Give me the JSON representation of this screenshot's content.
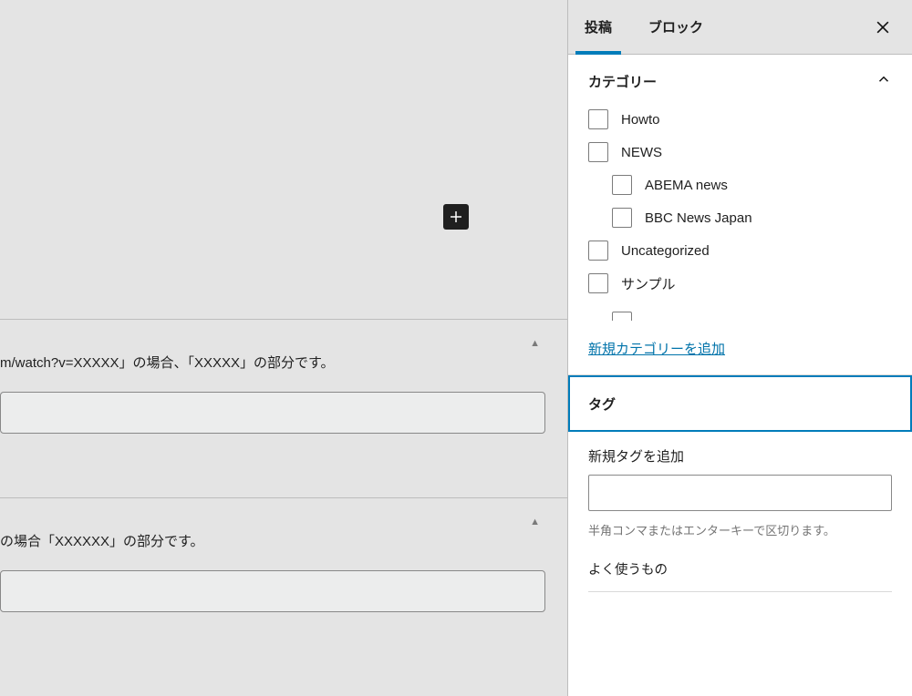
{
  "editor": {
    "section1_desc": "m/watch?v=XXXXX」の場合、「XXXXX」の部分です。",
    "section2_desc": "の場合「XXXXXX」の部分です。",
    "triangle_glyph": "▲"
  },
  "panel": {
    "tabs": {
      "post": "投稿",
      "block": "ブロック"
    },
    "categories": {
      "title": "カテゴリー",
      "items": [
        {
          "label": "Howto",
          "indent": 0
        },
        {
          "label": "NEWS",
          "indent": 0
        },
        {
          "label": "ABEMA news",
          "indent": 1
        },
        {
          "label": "BBC News Japan",
          "indent": 1
        },
        {
          "label": "Uncategorized",
          "indent": 0
        },
        {
          "label": "サンプル",
          "indent": 0
        }
      ],
      "add_link": "新規カテゴリーを追加"
    },
    "tags": {
      "title": "タグ",
      "add_label": "新規タグを追加",
      "help": "半角コンマまたはエンターキーで区切ります。",
      "frequent": "よく使うもの"
    }
  }
}
